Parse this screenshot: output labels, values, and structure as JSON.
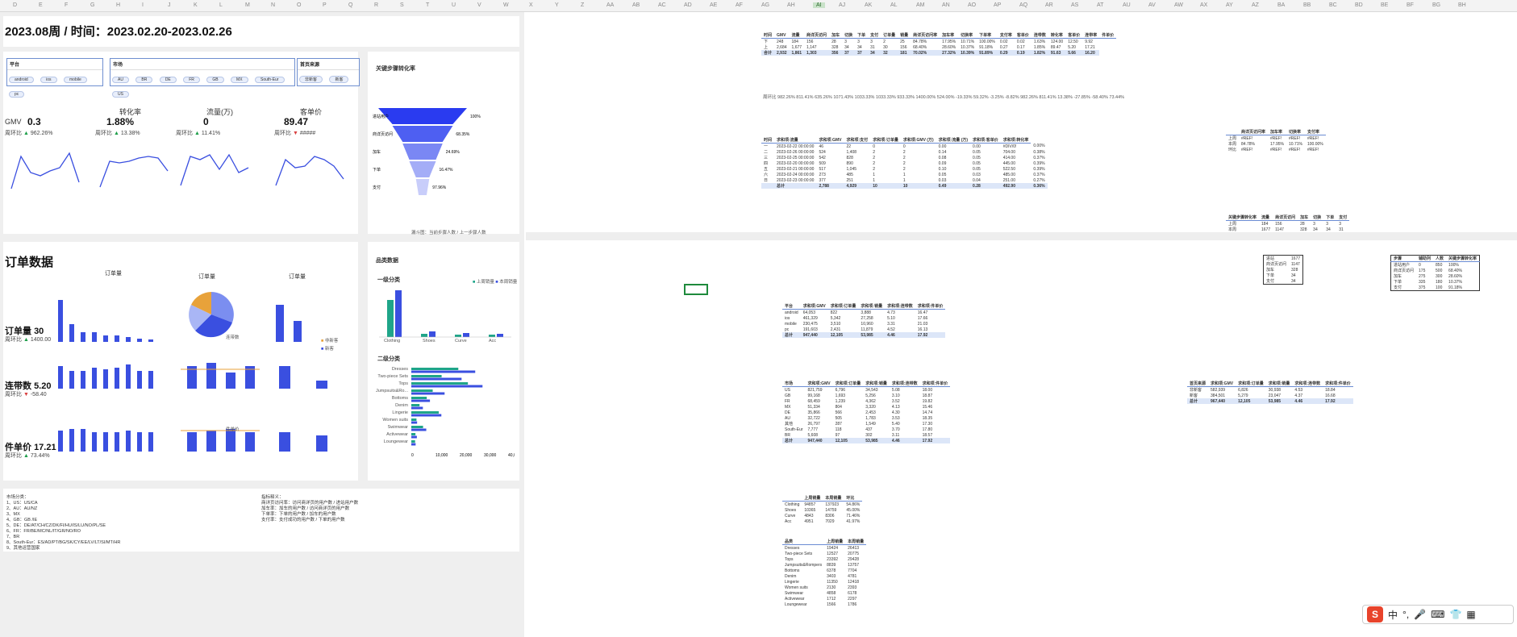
{
  "columns": [
    "D",
    "E",
    "F",
    "G",
    "H",
    "I",
    "J",
    "K",
    "L",
    "M",
    "N",
    "O",
    "P",
    "Q",
    "R",
    "S",
    "T",
    "U",
    "V",
    "W",
    "X",
    "Y",
    "Z",
    "AA",
    "AB",
    "AC",
    "AD",
    "AE",
    "AF",
    "AG",
    "AH",
    "AI",
    "AJ",
    "AK",
    "AL",
    "AM",
    "AN",
    "AO",
    "AP",
    "AQ",
    "AR",
    "AS",
    "AT",
    "AU",
    "AV",
    "AW",
    "AX",
    "AY",
    "AZ",
    "BA",
    "BB",
    "BC",
    "BD",
    "BE",
    "BF",
    "BG",
    "BH"
  ],
  "selected_column": "AI",
  "header": {
    "week_title": "2023.08周 / 时间：2023.02.20-2023.02.26"
  },
  "slicers": [
    {
      "title": "平台",
      "items": [
        "android",
        "ios",
        "mobile",
        "pc"
      ]
    },
    {
      "title": "市场",
      "items": [
        "AU",
        "BR",
        "DE",
        "FR",
        "GB",
        "MX",
        "South-Eur",
        "US"
      ]
    },
    {
      "title": "首页来源",
      "items": [
        "非新客",
        "新客"
      ]
    }
  ],
  "metrics": [
    {
      "label": "GMV",
      "value": "0.3",
      "wow_label": "周环比",
      "wow": "962.26%",
      "dir": "up"
    },
    {
      "label": "转化率",
      "value": "1.88%",
      "wow_label": "周环比",
      "wow": "13.38%",
      "dir": "up"
    },
    {
      "label": "流量(万)",
      "value": "0",
      "wow_label": "周环比",
      "wow": "11.41%",
      "dir": "up"
    },
    {
      "label": "客单价",
      "value": "89.47",
      "wow_label": "周环比",
      "wow": "#####",
      "dir": "down"
    }
  ],
  "funnel": {
    "title": "关键步骤转化率",
    "steps": [
      {
        "label": "进站用户",
        "pct": "100%",
        "value": 1.0
      },
      {
        "label": "商详页访问",
        "pct": "68.35%",
        "value": 0.68
      },
      {
        "label": "加车",
        "pct": "24.69%",
        "value": 0.45
      },
      {
        "label": "下单",
        "pct": "16.47%",
        "value": 0.3
      },
      {
        "label": "支付",
        "pct": "97.96%",
        "value": 0.15
      }
    ],
    "footer": "漏斗图：当前步骤人数 / 上一步骤人数"
  },
  "orders": {
    "section_title": "订单数据",
    "order_count": {
      "label": "订单量",
      "value": "30",
      "wow_label": "周环比",
      "wow": "1400.00"
    },
    "attach_rate": {
      "label": "连带数",
      "value": "5.20",
      "wow_label": "周环比",
      "wow": "-58.40",
      "sub": "(周环比)"
    },
    "piece_price": {
      "label": "件单价",
      "value": "17.21",
      "wow_label": "周环比",
      "wow": "73.44%",
      "sub": "(周环比)"
    },
    "chart1_title": "订单量",
    "pie_title": "订单量",
    "pie_legend": [
      "android",
      "ios",
      "mobile",
      "pc"
    ],
    "pie_pcts": [
      "21.7%",
      "6.4%",
      "45.4%"
    ],
    "chart_sub_title": "订单量",
    "legend_newold": [
      "非新客",
      "新客"
    ],
    "attach_title": "连带数",
    "piece_title": "件单价"
  },
  "category": {
    "title": "品类数据",
    "lvl1_title": "一级分类",
    "lvl2_title": "二级分类",
    "legend": [
      "上周销量",
      "本周销量"
    ],
    "lvl1": [
      "Clothing",
      "Shoes",
      "Curve",
      "Acc"
    ],
    "lvl1_labels": [
      "94,857",
      "137,923",
      "10,365",
      "14,759",
      "4,843",
      "8,306",
      "4,951",
      "7,029"
    ],
    "lvl2": [
      "Dresses",
      "Two-piece Sets",
      "Tops",
      "Jumpsuits&Ro...",
      "Bottoms",
      "Denim",
      "Lingerie",
      "Women suits",
      "Swimwear",
      "Activewear",
      "Loungewear"
    ],
    "lvl2_axis": [
      "0",
      "10,000",
      "20,000",
      "30,000",
      "40,000"
    ]
  },
  "notes": {
    "market_title": "市场分类：",
    "market_lines": [
      "1、US：US/CA",
      "2、AU：AU/NZ",
      "3、MX",
      "4、GB：GB /IE",
      "5、DE：DE/AT/CH/CZ/DK/FI/HU/IS/LU/NO/PL/SE",
      "6、FR：FR/BE/MC/NL/IT/GR/NO/RO",
      "7、BR",
      "8、South-Eur：ES/AD/PT/BG/SK/CY/EE/LV/LT/SI/MT/HR",
      "9、其他运营国家"
    ],
    "kpi_title": "指标释义：",
    "kpi_lines": [
      "商详页访问率：访问商详页的用户数 / 进站用户数",
      "加车率：加车的用户数 / 访问商详页的用户数",
      "下单率：下单的用户数 / 加车的用户数",
      "支付率：支付成功的用户数 / 下单的用户数"
    ]
  },
  "table1": {
    "headers": [
      "时间",
      "GMV",
      "流量",
      "商详页访问",
      "加车",
      "切换",
      "下单",
      "支付",
      "订单量",
      "销量",
      "商详页访问率",
      "加车率",
      "切换率",
      "下单率",
      "支付率",
      "客单价",
      "连带数",
      "转化率",
      "客单价",
      "连带率",
      "件单价"
    ],
    "rows": [
      [
        "下",
        "248",
        "184",
        "156",
        "28",
        "3",
        "3",
        "3",
        "2",
        "25",
        "84.78%",
        "17.95%",
        "10.71%",
        "100.00%",
        "0.02",
        "0.02",
        "1.63%",
        "124.00",
        "12.50",
        "9.92"
      ],
      [
        "上",
        "2,684",
        "1,677",
        "1,147",
        "328",
        "34",
        "34",
        "31",
        "30",
        "156",
        "68.40%",
        "28.60%",
        "10.37%",
        "91.18%",
        "0.27",
        "0.17",
        "1.85%",
        "89.47",
        "5.20",
        "17.21"
      ]
    ],
    "total": [
      "合计",
      "2,932",
      "1,861",
      "1,303",
      "356",
      "37",
      "37",
      "34",
      "32",
      "181",
      "70.02%",
      "27.32%",
      "10.39%",
      "91.89%",
      "0.29",
      "0.19",
      "1.82%",
      "91.63",
      "5.66",
      "16.20"
    ],
    "wow_label": "周环比",
    "wow": [
      "982.26%",
      "811.41%",
      "635.26%",
      "1071.43%",
      "1033.33%",
      "1033.33%",
      "933.33%",
      "1400.00%",
      "524.00%",
      "-19.33%",
      "59.32%",
      "-3.25%",
      "-8.82%",
      "982.26%",
      "811.41%",
      "13.38%",
      "-27.85%",
      "-58.40%",
      "73.44%"
    ]
  },
  "table2": {
    "headers": [
      "时间",
      "求和项:流量",
      "求和项:GMV",
      "求和项:支付",
      "求和项:订单量",
      "求和项:GMV (万)",
      "求和项:流量 (万)",
      "求和项:客单价",
      "求和项:转化率"
    ],
    "rows": [
      [
        "一",
        "2023-02-22 00:00:00",
        "46",
        "22",
        "0",
        "0",
        "0.00",
        "0.00",
        "#DIV/0!",
        "0.00%"
      ],
      [
        "二",
        "2023-02-26 00:00:00",
        "524",
        "1,408",
        "2",
        "2",
        "0.14",
        "0.05",
        "704.00",
        "0.38%"
      ],
      [
        "三",
        "2023-02-25 00:00:00",
        "542",
        "828",
        "2",
        "2",
        "0.08",
        "0.05",
        "414.00",
        "0.37%"
      ],
      [
        "四",
        "2023-02-20 00:00:00",
        "509",
        "890",
        "2",
        "2",
        "0.09",
        "0.05",
        "445.00",
        "0.39%"
      ],
      [
        "五",
        "2023-02-21 00:00:00",
        "517",
        "1,045",
        "2",
        "2",
        "0.10",
        "0.05",
        "522.50",
        "0.39%"
      ],
      [
        "六",
        "2023-02-24 00:00:00",
        "273",
        "485",
        "1",
        "1",
        "0.05",
        "0.03",
        "485.00",
        "0.37%"
      ],
      [
        "日",
        "2023-02-23 00:00:00",
        "377",
        "251",
        "1",
        "1",
        "0.03",
        "0.04",
        "251.00",
        "0.27%"
      ]
    ],
    "total": [
      "",
      "总计",
      "2,788",
      "4,929",
      "10",
      "10",
      "0.49",
      "0.28",
      "492.90",
      "0.36%"
    ]
  },
  "table_platform": {
    "filter": "时间",
    "headers": [
      "平台",
      "求和项:GMV",
      "求和项:订单量",
      "求和项:销量",
      "求和项:连带数",
      "求和项:件单价"
    ],
    "rows": [
      [
        "android",
        "64,053",
        "822",
        "3,888",
        "4.73",
        "16.47"
      ],
      [
        "ios",
        "461,329",
        "5,342",
        "27,258",
        "5.10",
        "17.66"
      ],
      [
        "mobile",
        "230,475",
        "3,510",
        "10,960",
        "3.31",
        "21.03"
      ],
      [
        "pc",
        "191,603",
        "2,431",
        "11,879",
        "4.52",
        "16.13"
      ]
    ],
    "total": [
      "总计",
      "947,440",
      "12,105",
      "53,985",
      "4.46",
      "17.92"
    ]
  },
  "table_market": {
    "filter": "时间",
    "headers": [
      "市场",
      "求和项:GMV",
      "求和项:订单量",
      "求和项:销量",
      "求和项:连带数",
      "求和项:件单价"
    ],
    "rows": [
      [
        "US",
        "821,759",
        "6,796",
        "34,543",
        "5.08",
        "18.00"
      ],
      [
        "GB",
        "99,168",
        "1,693",
        "5,256",
        "3.10",
        "18.87"
      ],
      [
        "FR",
        "68,459",
        "1,239",
        "4,362",
        "3.52",
        "19.82"
      ],
      [
        "MX",
        "51,334",
        "804",
        "3,320",
        "4.13",
        "15.46"
      ],
      [
        "DE",
        "35,866",
        "566",
        "2,453",
        "4.30",
        "14.74"
      ],
      [
        "AU",
        "32,722",
        "505",
        "1,783",
        "3.53",
        "18.35"
      ],
      [
        "其他",
        "26,797",
        "287",
        "1,549",
        "5.40",
        "17.30"
      ],
      [
        "South-Eur",
        "7,777",
        "118",
        "437",
        "3.70",
        "17.80"
      ],
      [
        "BR",
        "5,608",
        "97",
        "302",
        "3.11",
        "18.57"
      ]
    ],
    "total": [
      "总计",
      "947,440",
      "12,105",
      "53,985",
      "4.46",
      "17.92"
    ]
  },
  "table_newold": {
    "filter": "时间",
    "headers": [
      "首页来源",
      "求和项:GMV",
      "求和项:订单量",
      "求和项:销量",
      "求和项:连带数",
      "求和项:件单价"
    ],
    "rows": [
      [
        "非新客",
        "582,939",
        "6,826",
        "30,938",
        "4.53",
        "18.84"
      ],
      [
        "新客",
        "384,501",
        "5,279",
        "23,047",
        "4.37",
        "16.68"
      ]
    ],
    "total": [
      "总计",
      "967,440",
      "12,105",
      "53,985",
      "4.46",
      "17.92"
    ]
  },
  "table_lvl1": {
    "headers": [
      "",
      "上周销量",
      "本周销量",
      "环比"
    ],
    "rows": [
      [
        "Clothing",
        "94857",
        "137923",
        "54.86%"
      ],
      [
        "Shoes",
        "10365",
        "14759",
        "45.00%"
      ],
      [
        "Curve",
        "4843",
        "8306",
        "71.46%"
      ],
      [
        "Acc",
        "4951",
        "7029",
        "41.97%"
      ]
    ]
  },
  "table_lvl2": {
    "headers": [
      "品类",
      "上周销量",
      "本周销量"
    ],
    "rows": [
      [
        "Dresses",
        "19424",
        "26413"
      ],
      [
        "Two-piece Sets",
        "12527",
        "20775"
      ],
      [
        "Tops",
        "23392",
        "29428"
      ],
      [
        "Jumpsuits&Rompers",
        "8839",
        "13757"
      ],
      [
        "Bottoms",
        "6378",
        "7704"
      ],
      [
        "Denim",
        "3403",
        "4781"
      ],
      [
        "Lingerie",
        "11350",
        "12418"
      ],
      [
        "Women suits",
        "2130",
        "2393"
      ],
      [
        "Swimwear",
        "4858",
        "6178"
      ],
      [
        "Activewear",
        "1712",
        "2297"
      ],
      [
        "Loungewear",
        "1566",
        "1786"
      ]
    ]
  },
  "mini_funnel_table": {
    "headers": [
      "流量",
      "商详页访问",
      "加车",
      "切换",
      "下单",
      "支付"
    ],
    "title": "关键步骤转化率",
    "rows": [
      [
        "上周",
        "184",
        "156",
        "28",
        "3",
        "3",
        "3"
      ],
      [
        "本周",
        "1677",
        "1147",
        "328",
        "34",
        "34",
        "31"
      ]
    ]
  },
  "rate_table": {
    "headers": [
      "商详页访问率",
      "加车率",
      "切换率",
      "支付率"
    ],
    "up_label": "上周",
    "this_label": "本周",
    "ratio_label": "环比",
    "up": [
      "#REF!",
      "#REF!",
      "#REF!",
      "#REF!"
    ],
    "this": [
      "84.78%",
      "17.95%",
      "10.71%",
      "100.00%"
    ],
    "ratio": [
      "#REF!",
      "#REF!",
      "#REF!",
      "#REF!"
    ]
  },
  "funnel_helper": {
    "rows": [
      [
        "进站",
        "1677"
      ],
      [
        "商详页访问",
        "1147"
      ],
      [
        "加车",
        "328"
      ],
      [
        "下单",
        "34"
      ],
      [
        "支付",
        "34"
      ]
    ],
    "rows2": [
      [
        "进站用户",
        "0",
        "850",
        "100%"
      ],
      [
        "商详页访问",
        "175",
        "500",
        "68.40%"
      ],
      [
        "加车",
        "275",
        "300",
        "28.60%"
      ],
      [
        "下单",
        "335",
        "180",
        "10.37%"
      ],
      [
        "支付",
        "375",
        "100",
        "91.18%"
      ]
    ],
    "headers2": [
      "步骤",
      "辅助列",
      "人数",
      "关键步骤转化率"
    ]
  },
  "ime": {
    "logo": "S",
    "lang": "中",
    "punct": "°,"
  }
}
